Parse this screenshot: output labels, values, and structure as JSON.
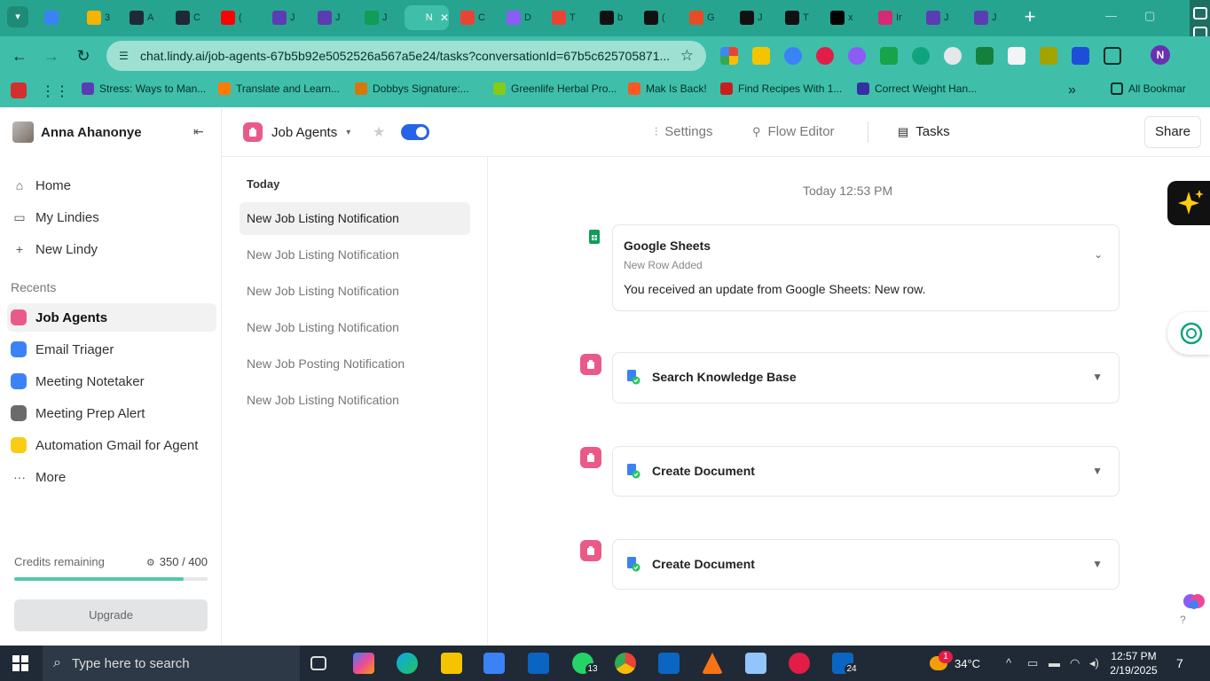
{
  "browser": {
    "tabs": [
      {
        "title": "",
        "color": "#3b82f6"
      },
      {
        "title": "3",
        "color": "#f5b400"
      },
      {
        "title": "A",
        "color": "#1f2937"
      },
      {
        "title": "C",
        "color": "#1f2937"
      },
      {
        "title": "(",
        "color": "#ff0000"
      },
      {
        "title": "J",
        "color": "#5b3db3"
      },
      {
        "title": "J",
        "color": "#5b3db3"
      },
      {
        "title": "J",
        "color": "#0f9d58"
      },
      {
        "title": "N",
        "color": "#3fbfa9"
      },
      {
        "title": "C",
        "color": "#ea4335"
      },
      {
        "title": "D",
        "color": "#8b5cf6"
      },
      {
        "title": "T",
        "color": "#ea4335"
      },
      {
        "title": "b",
        "color": "#111111"
      },
      {
        "title": "(",
        "color": "#111111"
      },
      {
        "title": "G",
        "color": "#e44d26"
      },
      {
        "title": "J",
        "color": "#111111"
      },
      {
        "title": "T",
        "color": "#111111"
      },
      {
        "title": "x",
        "color": "#000000"
      },
      {
        "title": "Ir",
        "color": "#d62976"
      },
      {
        "title": "J",
        "color": "#5b3db3"
      },
      {
        "title": "J",
        "color": "#5b3db3"
      }
    ],
    "url": "chat.lindy.ai/job-agents-67b5b92e5052526a567a5e24/tasks?conversationId=67b5c625705871...",
    "profile_initial": "N",
    "bookmarks": [
      {
        "label": "Stress: Ways to Man...",
        "color": "#5b3db3"
      },
      {
        "label": "Translate and Learn...",
        "color": "#ff7a00"
      },
      {
        "label": "Dobbys Signature:...",
        "color": "#d97706"
      },
      {
        "label": "Greenlife Herbal Pro...",
        "color": "#84cc16"
      },
      {
        "label": "Mak Is Back!",
        "color": "#ff5722"
      },
      {
        "label": "Find Recipes With 1...",
        "color": "#c81e1e"
      },
      {
        "label": "Correct Weight Han...",
        "color": "#3730a3"
      }
    ],
    "bookmarks_more": "»",
    "all_bookmarks": "All Bookmar"
  },
  "sidebar": {
    "user_name": "Anna Ahanonye",
    "nav": [
      {
        "label": "Home",
        "icon": "home-icon",
        "glyph": "⌂"
      },
      {
        "label": "My Lindies",
        "icon": "folder-icon",
        "glyph": "▭"
      },
      {
        "label": "New Lindy",
        "icon": "plus-icon",
        "glyph": "+"
      }
    ],
    "recents_label": "Recents",
    "recents": [
      {
        "label": "Job Agents",
        "color": "#ea5a89",
        "selected": true
      },
      {
        "label": "Email Triager",
        "color": "#3b82f6",
        "selected": false
      },
      {
        "label": "Meeting Notetaker",
        "color": "#3b82f6",
        "selected": false
      },
      {
        "label": "Meeting Prep Alert",
        "color": "#6b6b6b",
        "selected": false
      },
      {
        "label": "Automation Gmail for Agent",
        "color": "#facc15",
        "selected": false
      }
    ],
    "more_label": "More",
    "credits_label": "Credits remaining",
    "credits_value": "350 / 400",
    "credits_fraction": 0.875,
    "upgrade_label": "Upgrade"
  },
  "topbar": {
    "agent_name": "Job Agents",
    "tabs": [
      {
        "label": "Settings",
        "active": false
      },
      {
        "label": "Flow Editor",
        "active": false
      },
      {
        "label": "Tasks",
        "active": true
      }
    ],
    "share_label": "Share"
  },
  "tasklist": {
    "group_label": "Today",
    "items": [
      "New Job Listing Notification",
      "New Job Listing Notification",
      "New Job Listing Notification",
      "New Job Listing Notification",
      "New Job Posting Notification",
      "New Job Listing Notification"
    ]
  },
  "main": {
    "timestamp": "Today 12:53 PM",
    "trigger": {
      "title": "Google Sheets",
      "subtitle": "New Row Added",
      "body": "You received an update from Google Sheets: New row."
    },
    "steps": [
      {
        "title": "Search Knowledge Base"
      },
      {
        "title": "Create Document"
      },
      {
        "title": "Create Document"
      }
    ]
  },
  "taskbar": {
    "search_placeholder": "Type here to search",
    "whatsapp_badge": "13",
    "linkedin_badge": "24",
    "weather_badge": "1",
    "temperature": "34°C",
    "time": "12:57 PM",
    "date": "2/19/2025",
    "notifications": "7"
  }
}
